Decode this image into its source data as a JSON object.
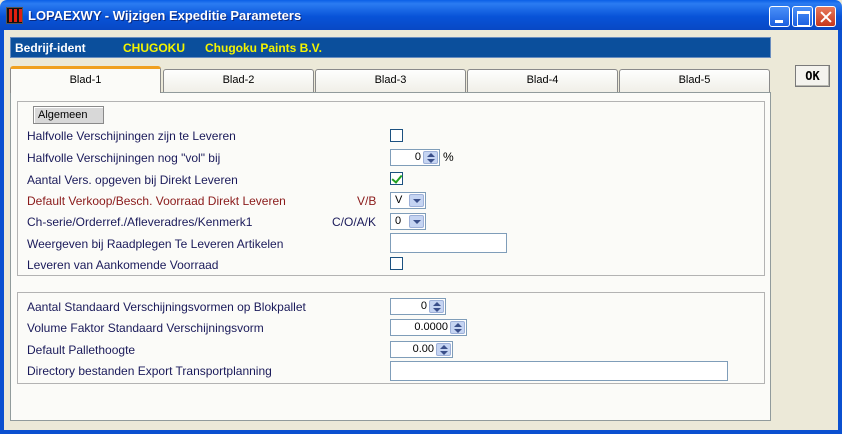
{
  "window": {
    "title": "LOPAEXWY - Wijzigen Expeditie Parameters"
  },
  "company": {
    "label": "Bedrijf-ident",
    "code": "CHUGOKU",
    "name": "Chugoku Paints B.V."
  },
  "tabs": [
    {
      "label": "Blad-1",
      "active": true
    },
    {
      "label": "Blad-2",
      "active": false
    },
    {
      "label": "Blad-3",
      "active": false
    },
    {
      "label": "Blad-4",
      "active": false
    },
    {
      "label": "Blad-5",
      "active": false
    }
  ],
  "ok_label": "OK",
  "section": {
    "label": "Algemeen"
  },
  "fields": {
    "halfvolle_leveren": {
      "label": "Halfvolle Verschijningen zijn te Leveren",
      "checked": false
    },
    "halfvolle_vol": {
      "label": "Halfvolle Verschijningen nog \"vol\" bij",
      "value": "0",
      "unit": "%"
    },
    "aantal_vers": {
      "label": "Aantal Vers. opgeven bij Direkt Leveren",
      "checked": true
    },
    "default_verkoop": {
      "label": "Default Verkoop/Besch. Voorraad Direkt Leveren",
      "code": "V/B",
      "value": "V"
    },
    "ch_serie": {
      "label": "Ch-serie/Orderref./Afleveradres/Kenmerk1",
      "code": "C/O/A/K",
      "value": "0"
    },
    "weergeven": {
      "label": "Weergeven bij Raadplegen Te Leveren Artikelen",
      "value": ""
    },
    "leveren_aankomende": {
      "label": "Leveren van Aankomende Voorraad",
      "checked": false
    },
    "aantal_standaard": {
      "label": "Aantal Standaard Verschijningsvormen op Blokpallet",
      "value": "0"
    },
    "volume_faktor": {
      "label": "Volume Faktor Standaard Verschijningsvorm",
      "value": "0.0000"
    },
    "pallethoogte": {
      "label": "Default Pallethoogte",
      "value": "0.00"
    },
    "directory": {
      "label": "Directory bestanden Export Transportplanning",
      "value": ""
    }
  },
  "colors": {
    "title_bar": "#0853d8",
    "company_bar": "#0b4f9c",
    "company_highlight": "#f4f400",
    "label_text": "#1a1a5a",
    "label_red": "#8a1a1a",
    "tab_active_accent": "#f0a020"
  }
}
